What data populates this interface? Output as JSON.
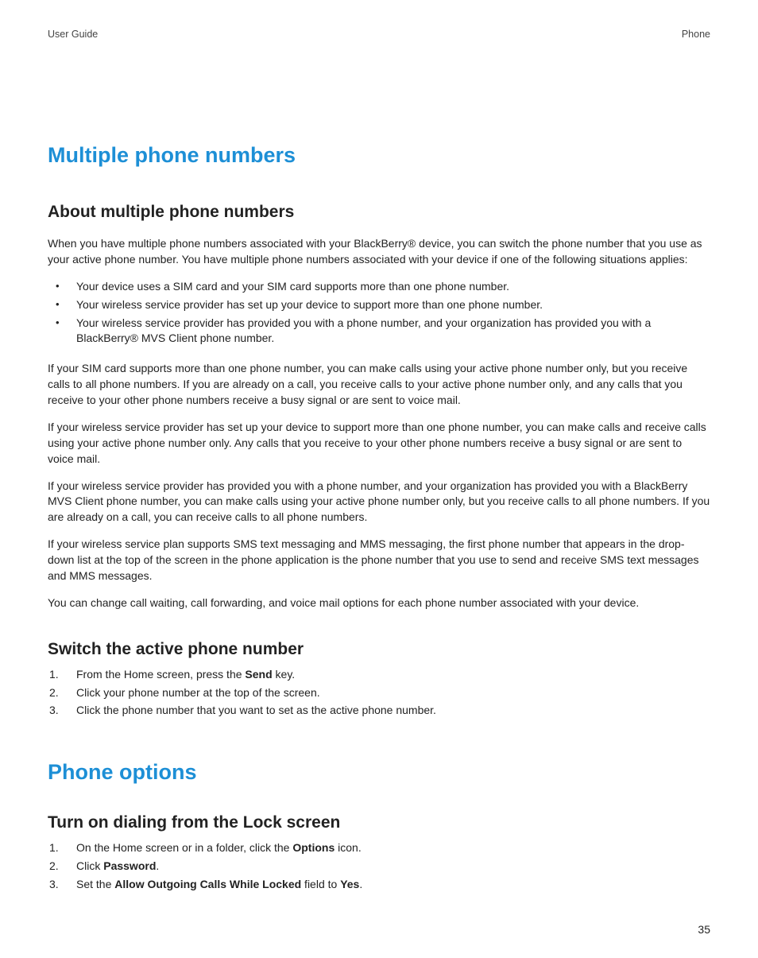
{
  "header": {
    "left": "User Guide",
    "right": "Phone"
  },
  "section1": {
    "title": "Multiple phone numbers",
    "sub1": {
      "title": "About multiple phone numbers",
      "p1": "When you have multiple phone numbers associated with your BlackBerry® device, you can switch the phone number that you use as your active phone number. You have multiple phone numbers associated with your device if one of the following situations applies:",
      "bullets": [
        "Your device uses a SIM card and your SIM card supports more than one phone number.",
        "Your wireless service provider has set up your device to support more than one phone number.",
        "Your wireless service provider has provided you with a phone number, and your organization has provided you with a BlackBerry® MVS Client phone number."
      ],
      "p2": "If your SIM card supports more than one phone number, you can make calls using your active phone number only, but you receive calls to all phone numbers. If you are already on a call, you receive calls to your active phone number only, and any calls that you receive to your other phone numbers receive a busy signal or are sent to voice mail.",
      "p3": "If your wireless service provider has set up your device to support more than one phone number, you can make calls and receive calls using your active phone number only. Any calls that you receive to your other phone numbers receive a busy signal or are sent to voice mail.",
      "p4": "If your wireless service provider has provided you with a phone number, and your organization has provided you with a BlackBerry MVS Client phone number, you can make calls using your active phone number only, but you receive calls to all phone numbers. If you are already on a call, you can receive calls to all phone numbers.",
      "p5": "If your wireless service plan supports SMS text messaging and MMS messaging, the first phone number that appears in the drop-down list at the top of the screen in the phone application is the phone number that you use to send and receive SMS text messages and MMS messages.",
      "p6": "You can change call waiting, call forwarding, and voice mail options for each phone number associated with your device."
    },
    "sub2": {
      "title": "Switch the active phone number",
      "steps": {
        "s1a": "From the Home screen, press the ",
        "s1b": "Send",
        "s1c": " key.",
        "s2": "Click your phone number at the top of the screen.",
        "s3": "Click the phone number that you want to set as the active phone number."
      }
    }
  },
  "section2": {
    "title": "Phone options",
    "sub1": {
      "title": "Turn on dialing from the Lock screen",
      "steps": {
        "s1a": "On the Home screen or in a folder, click the ",
        "s1b": "Options",
        "s1c": " icon.",
        "s2a": "Click ",
        "s2b": "Password",
        "s2c": ".",
        "s3a": "Set the ",
        "s3b": "Allow Outgoing Calls While Locked",
        "s3c": " field to ",
        "s3d": "Yes",
        "s3e": "."
      }
    }
  },
  "page_number": "35"
}
